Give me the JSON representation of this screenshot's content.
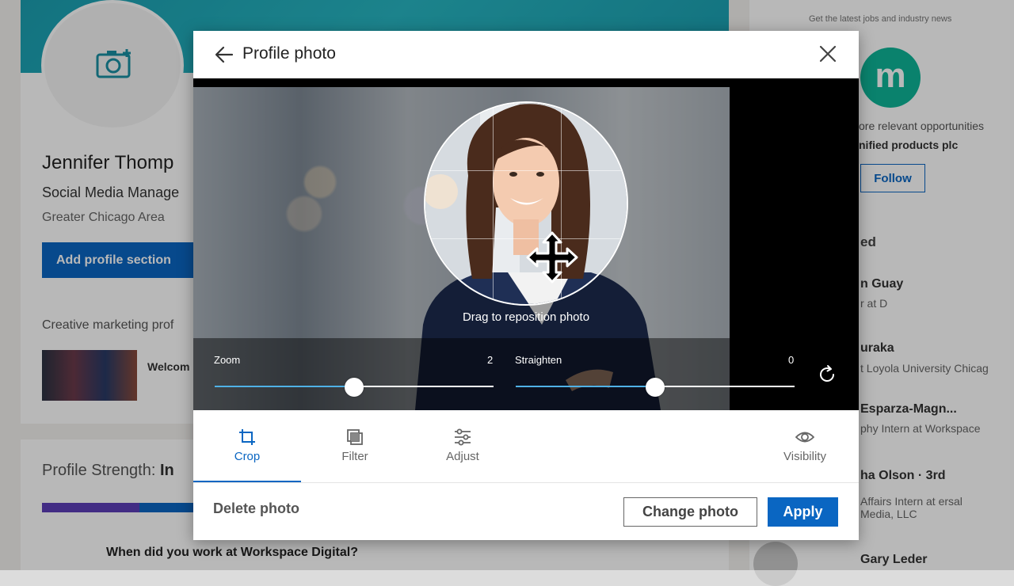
{
  "background": {
    "name": "Jennifer Thomp",
    "headline": "Social Media Manage",
    "location": "Greater Chicago Area",
    "add_section_label": "Add profile section",
    "creative_text": "Creative marketing prof",
    "welcome_text": "Welcom",
    "strength_label": "Profile Strength:",
    "strength_value": "In",
    "question": "When did you work at Workspace Digital?",
    "right_note": "Get the latest jobs and industry news",
    "company_letter": "m",
    "right_text1": "ore relevant opportunities",
    "right_text2": "nified products plc",
    "follow_label": "Follow",
    "people_title": "ed",
    "people": [
      {
        "name": "n Guay",
        "role": "r at D"
      },
      {
        "name": "uraka",
        "role": "t Loyola University Chicag"
      },
      {
        "name": "Esparza-Magn...",
        "role": "phy Intern at Workspace"
      },
      {
        "name": "ha Olson · 3rd",
        "role": "Affairs Intern at ersal Media, LLC"
      },
      {
        "name": "Gary Leder",
        "role": ""
      }
    ]
  },
  "modal": {
    "title": "Profile photo",
    "drag_hint": "Drag to reposition photo",
    "zoom": {
      "label": "Zoom",
      "value": "2",
      "fraction": 0.5
    },
    "straighten": {
      "label": "Straighten",
      "value": "0",
      "fraction": 0.5
    },
    "tabs": [
      {
        "label": "Crop",
        "icon": "crop-icon",
        "active": true
      },
      {
        "label": "Filter",
        "icon": "filter-icon",
        "active": false
      },
      {
        "label": "Adjust",
        "icon": "adjust-icon",
        "active": false
      },
      {
        "label": "Visibility",
        "icon": "eye-icon",
        "active": false
      }
    ],
    "delete_label": "Delete photo",
    "change_label": "Change photo",
    "apply_label": "Apply",
    "accent_color": "#0a66c2"
  }
}
